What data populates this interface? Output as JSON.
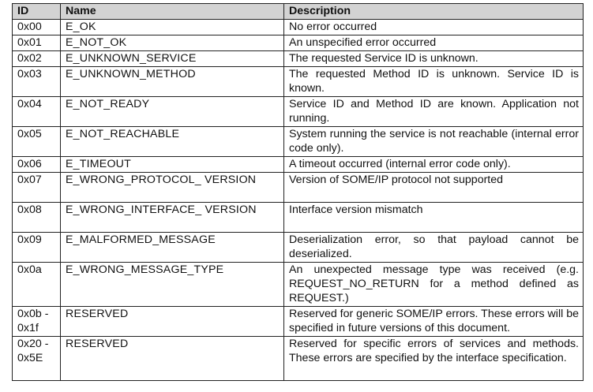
{
  "table": {
    "headers": {
      "id": "ID",
      "name": "Name",
      "description": "Description"
    },
    "rows": [
      {
        "id": "0x00",
        "name": "E_OK",
        "description": "No error occurred",
        "lines": 1
      },
      {
        "id": "0x01",
        "name": "E_NOT_OK",
        "description": "An unspecified error occurred",
        "lines": 1
      },
      {
        "id": "0x02",
        "name": "E_UNKNOWN_SERVICE",
        "description": "The requested Service ID is unknown.",
        "lines": 1
      },
      {
        "id": "0x03",
        "name": "E_UNKNOWN_METHOD",
        "description": "The requested Method ID is unknown. Service ID is known.",
        "lines": 2
      },
      {
        "id": "0x04",
        "name": "E_NOT_READY",
        "description": "Service ID and Method ID are known. Application not running.",
        "lines": 2
      },
      {
        "id": "0x05",
        "name": "E_NOT_REACHABLE",
        "description": "System running the service is not reachable (internal error code only).",
        "lines": 2
      },
      {
        "id": "0x06",
        "name": "E_TIMEOUT",
        "description": "A timeout occurred (internal error code only).",
        "lines": 1
      },
      {
        "id": "0x07",
        "name": "E_WRONG_PROTOCOL_ VERSION",
        "description": "Version of SOME/IP protocol not supported",
        "lines": 2
      },
      {
        "id": "0x08",
        "name": "E_WRONG_INTERFACE_ VERSION",
        "description": "Interface version mismatch",
        "lines": 2
      },
      {
        "id": "0x09",
        "name": "E_MALFORMED_MESSAGE",
        "description": "Deserialization error, so that payload cannot be deserialized.",
        "lines": 2
      },
      {
        "id": "0x0a",
        "name": "E_WRONG_MESSAGE_TYPE",
        "description": "An unexpected message type was received (e.g. REQUEST_NO_RETURN for a method defined as REQUEST.)",
        "lines": 3
      },
      {
        "id": "0x0b - 0x1f",
        "name": "RESERVED",
        "description": "Reserved for generic SOME/IP errors. These errors will be specified in future versions of this document.",
        "lines": 2
      },
      {
        "id": "0x20 - 0x5E",
        "name": "RESERVED",
        "description": "Reserved for specific errors of services and methods. These errors are specified by the interface specification.",
        "lines": 3
      }
    ]
  }
}
